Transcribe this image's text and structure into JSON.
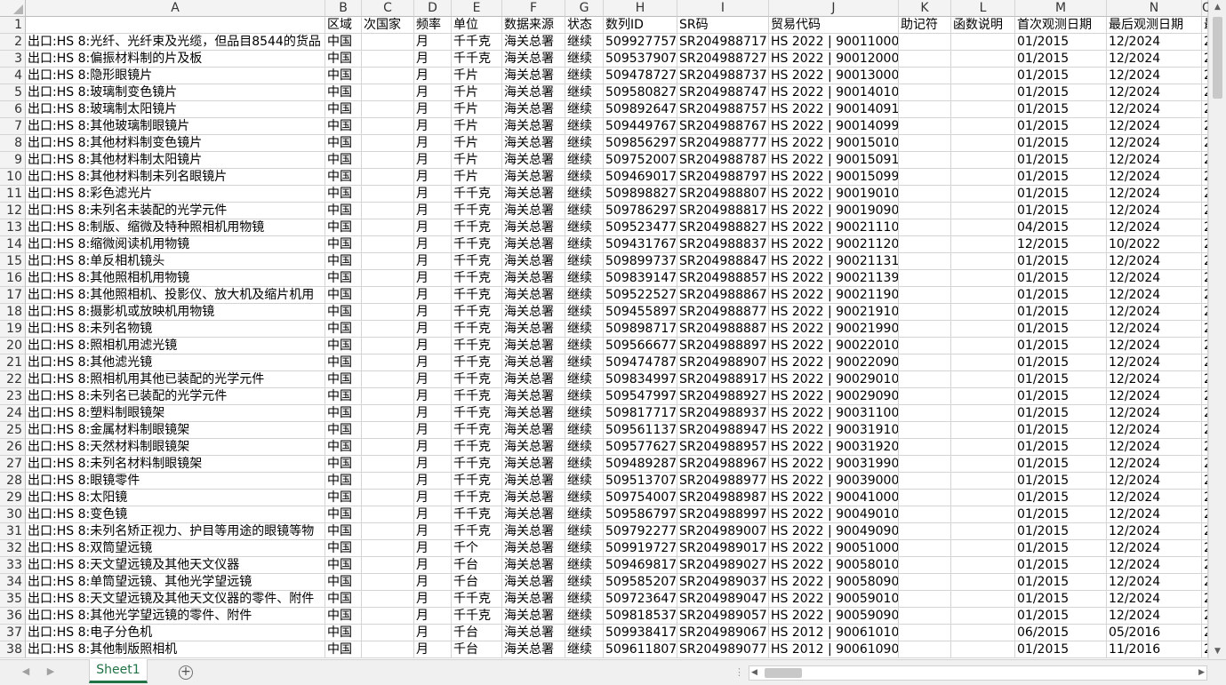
{
  "columns": [
    "A",
    "B",
    "C",
    "D",
    "E",
    "F",
    "G",
    "H",
    "I",
    "J",
    "K",
    "L",
    "M",
    "N",
    "O"
  ],
  "headers": [
    "",
    "区域",
    "次国家",
    "频率",
    "单位",
    "数据来源",
    "状态",
    "数列ID",
    "SR码",
    "贸易代码",
    "助记符",
    "函数说明",
    "首次观测日期",
    "最后观测日期",
    "最"
  ],
  "rows": [
    [
      "出口:HS 8:光纤、光纤束及光缆，但品目8544的货品",
      "中国",
      "",
      "月",
      "千千克",
      "海关总署",
      "继续",
      "509927757",
      "SR204988717",
      "HS 2022 | 90011000",
      "",
      "",
      "01/2015",
      "12/2024",
      "2"
    ],
    [
      "出口:HS 8:偏振材料制的片及板",
      "中国",
      "",
      "月",
      "千千克",
      "海关总署",
      "继续",
      "509537907",
      "SR204988727",
      "HS 2022 | 90012000",
      "",
      "",
      "01/2015",
      "12/2024",
      "2"
    ],
    [
      "出口:HS 8:隐形眼镜片",
      "中国",
      "",
      "月",
      "千片",
      "海关总署",
      "继续",
      "509478727",
      "SR204988737",
      "HS 2022 | 90013000",
      "",
      "",
      "01/2015",
      "12/2024",
      "2"
    ],
    [
      "出口:HS 8:玻璃制变色镜片",
      "中国",
      "",
      "月",
      "千片",
      "海关总署",
      "继续",
      "509580827",
      "SR204988747",
      "HS 2022 | 90014010",
      "",
      "",
      "01/2015",
      "12/2024",
      "2"
    ],
    [
      "出口:HS 8:玻璃制太阳镜片",
      "中国",
      "",
      "月",
      "千片",
      "海关总署",
      "继续",
      "509892647",
      "SR204988757",
      "HS 2022 | 90014091",
      "",
      "",
      "01/2015",
      "12/2024",
      "2"
    ],
    [
      "出口:HS 8:其他玻璃制眼镜片",
      "中国",
      "",
      "月",
      "千片",
      "海关总署",
      "继续",
      "509449767",
      "SR204988767",
      "HS 2022 | 90014099",
      "",
      "",
      "01/2015",
      "12/2024",
      "2"
    ],
    [
      "出口:HS 8:其他材料制变色镜片",
      "中国",
      "",
      "月",
      "千片",
      "海关总署",
      "继续",
      "509856297",
      "SR204988777",
      "HS 2022 | 90015010",
      "",
      "",
      "01/2015",
      "12/2024",
      "2"
    ],
    [
      "出口:HS 8:其他材料制太阳镜片",
      "中国",
      "",
      "月",
      "千片",
      "海关总署",
      "继续",
      "509752007",
      "SR204988787",
      "HS 2022 | 90015091",
      "",
      "",
      "01/2015",
      "12/2024",
      "2"
    ],
    [
      "出口:HS 8:其他材料制未列名眼镜片",
      "中国",
      "",
      "月",
      "千片",
      "海关总署",
      "继续",
      "509469017",
      "SR204988797",
      "HS 2022 | 90015099",
      "",
      "",
      "01/2015",
      "12/2024",
      "2"
    ],
    [
      "出口:HS 8:彩色滤光片",
      "中国",
      "",
      "月",
      "千千克",
      "海关总署",
      "继续",
      "509898827",
      "SR204988807",
      "HS 2022 | 90019010",
      "",
      "",
      "01/2015",
      "12/2024",
      "2"
    ],
    [
      "出口:HS 8:未列名未装配的光学元件",
      "中国",
      "",
      "月",
      "千千克",
      "海关总署",
      "继续",
      "509786297",
      "SR204988817",
      "HS 2022 | 90019090",
      "",
      "",
      "01/2015",
      "12/2024",
      "2"
    ],
    [
      "出口:HS 8:制版、缩微及特种照相机用物镜",
      "中国",
      "",
      "月",
      "千千克",
      "海关总署",
      "继续",
      "509523477",
      "SR204988827",
      "HS 2022 | 90021110",
      "",
      "",
      "04/2015",
      "12/2024",
      "2"
    ],
    [
      "出口:HS 8:缩微阅读机用物镜",
      "中国",
      "",
      "月",
      "千千克",
      "海关总署",
      "继续",
      "509431767",
      "SR204988837",
      "HS 2022 | 90021120",
      "",
      "",
      "12/2015",
      "10/2022",
      "2"
    ],
    [
      "出口:HS 8:单反相机镜头",
      "中国",
      "",
      "月",
      "千千克",
      "海关总署",
      "继续",
      "509899737",
      "SR204988847",
      "HS 2022 | 90021131",
      "",
      "",
      "01/2015",
      "12/2024",
      "2"
    ],
    [
      "出口:HS 8:其他照相机用物镜",
      "中国",
      "",
      "月",
      "千千克",
      "海关总署",
      "继续",
      "509839147",
      "SR204988857",
      "HS 2022 | 90021139",
      "",
      "",
      "01/2015",
      "12/2024",
      "2"
    ],
    [
      "出口:HS 8:其他照相机、投影仪、放大机及缩片机用",
      "中国",
      "",
      "月",
      "千千克",
      "海关总署",
      "继续",
      "509522527",
      "SR204988867",
      "HS 2022 | 90021190",
      "",
      "",
      "01/2015",
      "12/2024",
      "2"
    ],
    [
      "出口:HS 8:摄影机或放映机用物镜",
      "中国",
      "",
      "月",
      "千千克",
      "海关总署",
      "继续",
      "509455897",
      "SR204988877",
      "HS 2022 | 90021910",
      "",
      "",
      "01/2015",
      "12/2024",
      "2"
    ],
    [
      "出口:HS 8:未列名物镜",
      "中国",
      "",
      "月",
      "千千克",
      "海关总署",
      "继续",
      "509898717",
      "SR204988887",
      "HS 2022 | 90021990",
      "",
      "",
      "01/2015",
      "12/2024",
      "2"
    ],
    [
      "出口:HS 8:照相机用滤光镜",
      "中国",
      "",
      "月",
      "千千克",
      "海关总署",
      "继续",
      "509566677",
      "SR204988897",
      "HS 2022 | 90022010",
      "",
      "",
      "01/2015",
      "12/2024",
      "2"
    ],
    [
      "出口:HS 8:其他滤光镜",
      "中国",
      "",
      "月",
      "千千克",
      "海关总署",
      "继续",
      "509474787",
      "SR204988907",
      "HS 2022 | 90022090",
      "",
      "",
      "01/2015",
      "12/2024",
      "2"
    ],
    [
      "出口:HS 8:照相机用其他已装配的光学元件",
      "中国",
      "",
      "月",
      "千千克",
      "海关总署",
      "继续",
      "509834997",
      "SR204988917",
      "HS 2022 | 90029010",
      "",
      "",
      "01/2015",
      "12/2024",
      "2"
    ],
    [
      "出口:HS 8:未列名已装配的光学元件",
      "中国",
      "",
      "月",
      "千千克",
      "海关总署",
      "继续",
      "509547997",
      "SR204988927",
      "HS 2022 | 90029090",
      "",
      "",
      "01/2015",
      "12/2024",
      "2"
    ],
    [
      "出口:HS 8:塑料制眼镜架",
      "中国",
      "",
      "月",
      "千千克",
      "海关总署",
      "继续",
      "509817717",
      "SR204988937",
      "HS 2022 | 90031100",
      "",
      "",
      "01/2015",
      "12/2024",
      "2"
    ],
    [
      "出口:HS 8:金属材料制眼镜架",
      "中国",
      "",
      "月",
      "千千克",
      "海关总署",
      "继续",
      "509561137",
      "SR204988947",
      "HS 2022 | 90031910",
      "",
      "",
      "01/2015",
      "12/2024",
      "2"
    ],
    [
      "出口:HS 8:天然材料制眼镜架",
      "中国",
      "",
      "月",
      "千千克",
      "海关总署",
      "继续",
      "509577627",
      "SR204988957",
      "HS 2022 | 90031920",
      "",
      "",
      "01/2015",
      "12/2024",
      "2"
    ],
    [
      "出口:HS 8:未列名材料制眼镜架",
      "中国",
      "",
      "月",
      "千千克",
      "海关总署",
      "继续",
      "509489287",
      "SR204988967",
      "HS 2022 | 90031990",
      "",
      "",
      "01/2015",
      "12/2024",
      "2"
    ],
    [
      "出口:HS 8:眼镜零件",
      "中国",
      "",
      "月",
      "千千克",
      "海关总署",
      "继续",
      "509513707",
      "SR204988977",
      "HS 2022 | 90039000",
      "",
      "",
      "01/2015",
      "12/2024",
      "2"
    ],
    [
      "出口:HS 8:太阳镜",
      "中国",
      "",
      "月",
      "千千克",
      "海关总署",
      "继续",
      "509754007",
      "SR204988987",
      "HS 2022 | 90041000",
      "",
      "",
      "01/2015",
      "12/2024",
      "2"
    ],
    [
      "出口:HS 8:变色镜",
      "中国",
      "",
      "月",
      "千千克",
      "海关总署",
      "继续",
      "509586797",
      "SR204988997",
      "HS 2022 | 90049010",
      "",
      "",
      "01/2015",
      "12/2024",
      "2"
    ],
    [
      "出口:HS 8:未列名矫正视力、护目等用途的眼镜等物",
      "中国",
      "",
      "月",
      "千千克",
      "海关总署",
      "继续",
      "509792277",
      "SR204989007",
      "HS 2022 | 90049090",
      "",
      "",
      "01/2015",
      "12/2024",
      "2"
    ],
    [
      "出口:HS 8:双筒望远镜",
      "中国",
      "",
      "月",
      "千个",
      "海关总署",
      "继续",
      "509919727",
      "SR204989017",
      "HS 2022 | 90051000",
      "",
      "",
      "01/2015",
      "12/2024",
      "2"
    ],
    [
      "出口:HS 8:天文望远镜及其他天文仪器",
      "中国",
      "",
      "月",
      "千台",
      "海关总署",
      "继续",
      "509469817",
      "SR204989027",
      "HS 2022 | 90058010",
      "",
      "",
      "01/2015",
      "12/2024",
      "2"
    ],
    [
      "出口:HS 8:单筒望远镜、其他光学望远镜",
      "中国",
      "",
      "月",
      "千台",
      "海关总署",
      "继续",
      "509585207",
      "SR204989037",
      "HS 2022 | 90058090",
      "",
      "",
      "01/2015",
      "12/2024",
      "2"
    ],
    [
      "出口:HS 8:天文望远镜及其他天文仪器的零件、附件",
      "中国",
      "",
      "月",
      "千千克",
      "海关总署",
      "继续",
      "509723647",
      "SR204989047",
      "HS 2022 | 90059010",
      "",
      "",
      "01/2015",
      "12/2024",
      "2"
    ],
    [
      "出口:HS 8:其他光学望远镜的零件、附件",
      "中国",
      "",
      "月",
      "千千克",
      "海关总署",
      "继续",
      "509818537",
      "SR204989057",
      "HS 2022 | 90059090",
      "",
      "",
      "01/2015",
      "12/2024",
      "2"
    ],
    [
      "出口:HS 8:电子分色机",
      "中国",
      "",
      "月",
      "千台",
      "海关总署",
      "继续",
      "509938417",
      "SR204989067",
      "HS 2012 | 90061010",
      "",
      "",
      "06/2015",
      "05/2016",
      "2"
    ],
    [
      "出口:HS 8:其他制版照相机",
      "中国",
      "",
      "月",
      "千台",
      "海关总署",
      "继续",
      "509611807",
      "SR204989077",
      "HS 2012 | 90061090",
      "",
      "",
      "01/2015",
      "11/2016",
      "2"
    ]
  ],
  "numeric_columns": [
    7
  ],
  "sheet_tab": "Sheet1",
  "add_sheet_symbol": "+",
  "split_symbol": "⋮"
}
